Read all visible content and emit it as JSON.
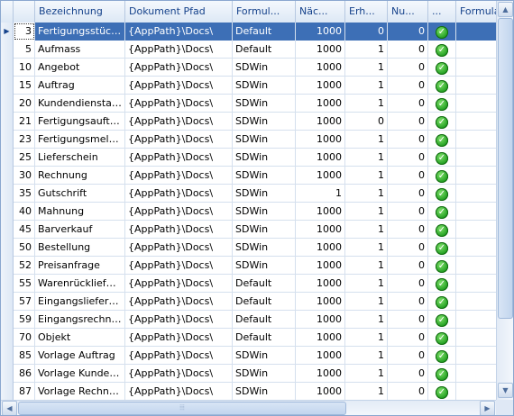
{
  "columns": [
    "",
    "",
    "Bezeichnung",
    "Dokument Pfad",
    "Formul...",
    "Näc...",
    "Erh...",
    "Nu...",
    "...",
    "Formular"
  ],
  "rows": [
    {
      "id": "3",
      "name": "Fertigungsstückli...",
      "path": "{AppPath}\\Docs\\",
      "form": "Default",
      "next": "1000",
      "inc": "0",
      "num": "0",
      "selected": true
    },
    {
      "id": "5",
      "name": "Aufmass",
      "path": "{AppPath}\\Docs\\",
      "form": "Default",
      "next": "1000",
      "inc": "1",
      "num": "0"
    },
    {
      "id": "10",
      "name": "Angebot",
      "path": "{AppPath}\\Docs\\",
      "form": "SDWin",
      "next": "1000",
      "inc": "1",
      "num": "0"
    },
    {
      "id": "15",
      "name": "Auftrag",
      "path": "{AppPath}\\Docs\\",
      "form": "SDWin",
      "next": "1000",
      "inc": "1",
      "num": "0"
    },
    {
      "id": "20",
      "name": "Kundendienstauf...",
      "path": "{AppPath}\\Docs\\",
      "form": "SDWin",
      "next": "1000",
      "inc": "1",
      "num": "0"
    },
    {
      "id": "21",
      "name": "Fertigungsauftrag",
      "path": "{AppPath}\\Docs\\",
      "form": "SDWin",
      "next": "1000",
      "inc": "0",
      "num": "0"
    },
    {
      "id": "23",
      "name": "Fertigungsmeldung",
      "path": "{AppPath}\\Docs\\",
      "form": "SDWin",
      "next": "1000",
      "inc": "1",
      "num": "0"
    },
    {
      "id": "25",
      "name": "Lieferschein",
      "path": "{AppPath}\\Docs\\",
      "form": "SDWin",
      "next": "1000",
      "inc": "1",
      "num": "0"
    },
    {
      "id": "30",
      "name": "Rechnung",
      "path": "{AppPath}\\Docs\\",
      "form": "SDWin",
      "next": "1000",
      "inc": "1",
      "num": "0"
    },
    {
      "id": "35",
      "name": "Gutschrift",
      "path": "{AppPath}\\Docs\\",
      "form": "SDWin",
      "next": "1",
      "inc": "1",
      "num": "0"
    },
    {
      "id": "40",
      "name": "Mahnung",
      "path": "{AppPath}\\Docs\\",
      "form": "SDWin",
      "next": "1000",
      "inc": "1",
      "num": "0"
    },
    {
      "id": "45",
      "name": "Barverkauf",
      "path": "{AppPath}\\Docs\\",
      "form": "SDWin",
      "next": "1000",
      "inc": "1",
      "num": "0"
    },
    {
      "id": "50",
      "name": "Bestellung",
      "path": "{AppPath}\\Docs\\",
      "form": "SDWin",
      "next": "1000",
      "inc": "1",
      "num": "0"
    },
    {
      "id": "52",
      "name": "Preisanfrage",
      "path": "{AppPath}\\Docs\\",
      "form": "SDWin",
      "next": "1000",
      "inc": "1",
      "num": "0"
    },
    {
      "id": "55",
      "name": "Warenrücklieferung",
      "path": "{AppPath}\\Docs\\",
      "form": "Default",
      "next": "1000",
      "inc": "1",
      "num": "0"
    },
    {
      "id": "57",
      "name": "Eingangsliefersc...",
      "path": "{AppPath}\\Docs\\",
      "form": "Default",
      "next": "1000",
      "inc": "1",
      "num": "0"
    },
    {
      "id": "59",
      "name": "Eingangsrechnung",
      "path": "{AppPath}\\Docs\\",
      "form": "Default",
      "next": "1000",
      "inc": "1",
      "num": "0"
    },
    {
      "id": "70",
      "name": "Objekt",
      "path": "{AppPath}\\Docs\\",
      "form": "Default",
      "next": "1000",
      "inc": "1",
      "num": "0"
    },
    {
      "id": "85",
      "name": "Vorlage Auftrag",
      "path": "{AppPath}\\Docs\\",
      "form": "SDWin",
      "next": "1000",
      "inc": "1",
      "num": "0"
    },
    {
      "id": "86",
      "name": "Vorlage Kundend...",
      "path": "{AppPath}\\Docs\\",
      "form": "SDWin",
      "next": "1000",
      "inc": "1",
      "num": "0"
    },
    {
      "id": "87",
      "name": "Vorlage Rechnung",
      "path": "{AppPath}\\Docs\\",
      "form": "SDWin",
      "next": "1000",
      "inc": "1",
      "num": "0"
    }
  ],
  "icons": {
    "active": "check-circle-icon",
    "row_pointer": "row-pointer-icon"
  },
  "colors": {
    "selection": "#3d6fb6",
    "header": "#dde8f5",
    "check": "#1f9d1f"
  }
}
